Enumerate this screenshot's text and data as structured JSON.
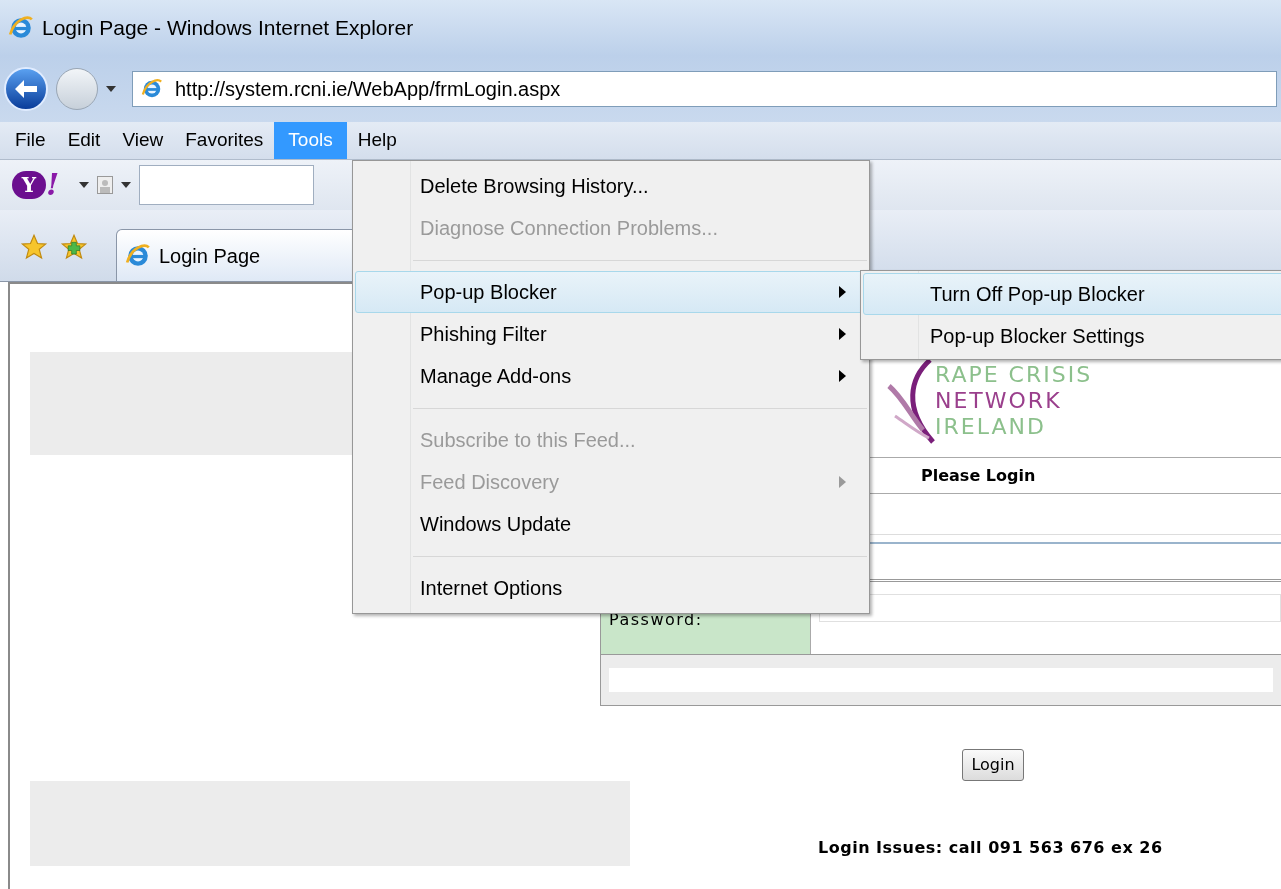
{
  "window": {
    "title": "Login Page - Windows Internet Explorer"
  },
  "address_bar": {
    "url": "http://system.rcni.ie/WebApp/frmLogin.aspx"
  },
  "menu_bar": [
    {
      "label": "File",
      "selected": false
    },
    {
      "label": "Edit",
      "selected": false
    },
    {
      "label": "View",
      "selected": false
    },
    {
      "label": "Favorites",
      "selected": false
    },
    {
      "label": "Tools",
      "selected": true
    },
    {
      "label": "Help",
      "selected": false
    }
  ],
  "search_toolbar": {
    "logo_letter": "Y",
    "logo_mark": "!"
  },
  "tabs": [
    {
      "label": "Login Page",
      "selected": true
    }
  ],
  "tools_menu": [
    {
      "kind": "item",
      "label": "Delete Browsing History...",
      "disabled": false,
      "submenu": false,
      "selected": false
    },
    {
      "kind": "item",
      "label": "Diagnose Connection Problems...",
      "disabled": true,
      "submenu": false,
      "selected": false
    },
    {
      "kind": "separator"
    },
    {
      "kind": "item",
      "label": "Pop-up Blocker",
      "disabled": false,
      "submenu": true,
      "selected": true
    },
    {
      "kind": "item",
      "label": "Phishing Filter",
      "disabled": false,
      "submenu": true,
      "selected": false
    },
    {
      "kind": "item",
      "label": "Manage Add-ons",
      "disabled": false,
      "submenu": true,
      "selected": false
    },
    {
      "kind": "separator"
    },
    {
      "kind": "item",
      "label": "Subscribe to this Feed...",
      "disabled": true,
      "submenu": false,
      "selected": false
    },
    {
      "kind": "item",
      "label": "Feed Discovery",
      "disabled": true,
      "submenu": true,
      "selected": false
    },
    {
      "kind": "item",
      "label": "Windows Update",
      "disabled": false,
      "submenu": false,
      "selected": false
    },
    {
      "kind": "separator"
    },
    {
      "kind": "item",
      "label": "Internet Options",
      "disabled": false,
      "submenu": false,
      "selected": false
    }
  ],
  "submenu": [
    {
      "label": "Turn Off Pop-up Blocker",
      "selected": true
    },
    {
      "label": "Pop-up Blocker Settings",
      "selected": false
    }
  ],
  "page": {
    "logo_lines": [
      {
        "text": "RAPE CRISIS",
        "color": "#8cc08c"
      },
      {
        "text": "NETWORK",
        "color": "#9a3f8c"
      },
      {
        "text": "IRELAND",
        "color": "#8cc08c"
      }
    ],
    "form_title": "Please Login",
    "password_label": "Password:",
    "login_button": "Login",
    "help_text": "Login Issues: call 091 563 676 ex 26"
  }
}
